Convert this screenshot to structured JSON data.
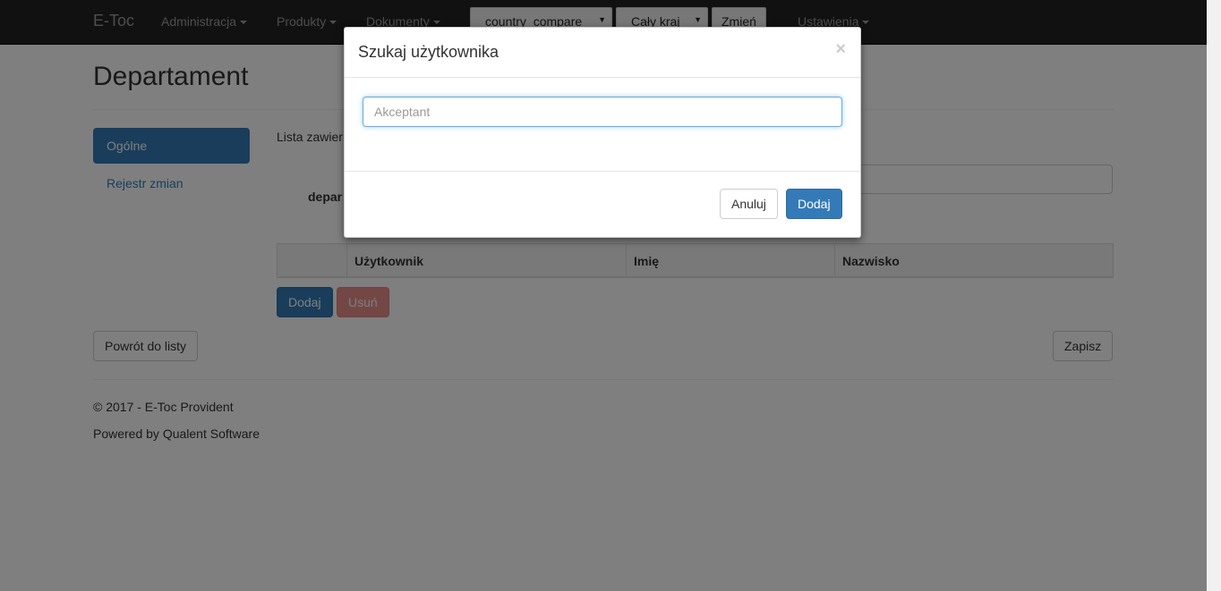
{
  "navbar": {
    "brand": "E-Toc",
    "menu": [
      "Administracja",
      "Produkty",
      "Dokumenty"
    ],
    "country_select": "country_compare",
    "region_select": "Cały kraj",
    "change_button": "Zmień",
    "settings": "Ustawienia"
  },
  "page": {
    "title": "Departament",
    "sidebar": [
      "Ogólne",
      "Rejestr zmian"
    ],
    "list_text": "Lista zawier",
    "field_label": "depar",
    "table_headers": [
      "",
      "Użytkownik",
      "Imię",
      "Nazwisko"
    ],
    "add_button": "Dodaj",
    "remove_button": "Usuń",
    "back_button": "Powrót do listy",
    "save_button": "Zapisz"
  },
  "footer": {
    "copyright": "© 2017 - E-Toc Provident",
    "powered_by": "Powered by Qualent Software"
  },
  "modal": {
    "title": "Szukaj użytkownika",
    "close_symbol": "×",
    "input_value": "",
    "input_placeholder": "Akceptant",
    "cancel_button": "Anuluj",
    "add_button": "Dodaj"
  },
  "colors": {
    "navbar_bg": "#222222",
    "primary": "#337ab7",
    "danger": "#d9534f"
  }
}
